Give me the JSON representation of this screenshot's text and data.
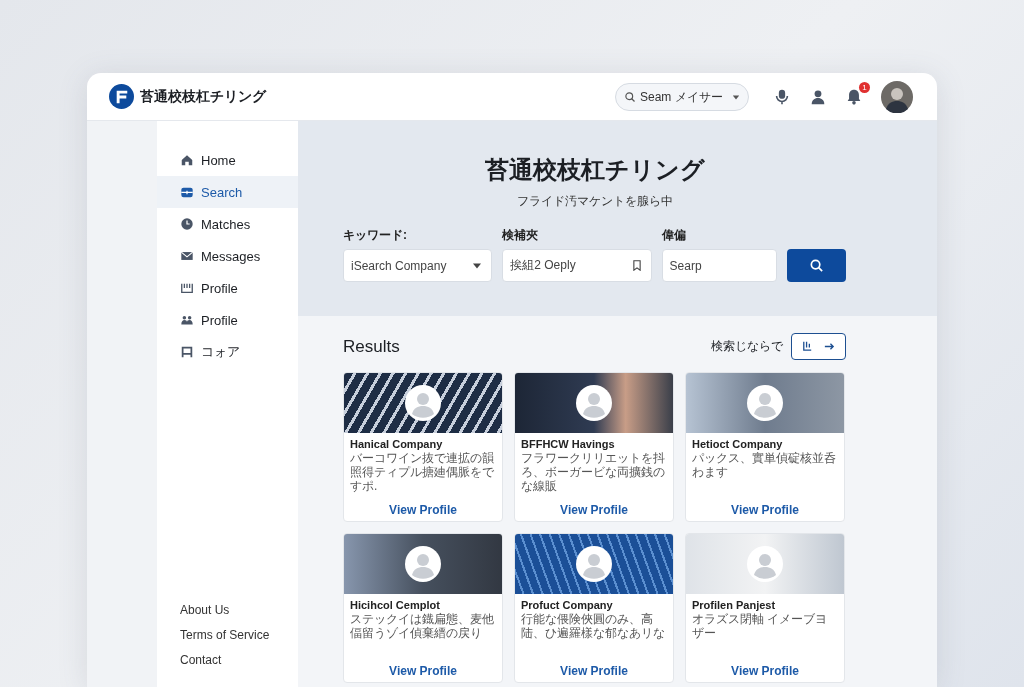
{
  "header": {
    "logo_text": "苔通校枝杠チリング",
    "search": {
      "placeholder": "Seam メイサー"
    },
    "notification_count": "1"
  },
  "sidebar": {
    "items": [
      {
        "label": "Home",
        "selected": false
      },
      {
        "label": "Search",
        "selected": true
      },
      {
        "label": "Matches",
        "selected": false
      },
      {
        "label": "Messages",
        "selected": false
      },
      {
        "label": "Profile",
        "selected": false
      },
      {
        "label": "Profile",
        "selected": false
      },
      {
        "label": "コォア",
        "selected": false
      }
    ],
    "footer_links": [
      "About Us",
      "Terms of Service",
      "Contact"
    ]
  },
  "hero": {
    "title": "苔通校枝杠チリング",
    "subtitle": "フライド汚マケントを腺ら中",
    "fields": [
      {
        "label": "キッワード:",
        "value": "iSearch Company",
        "kind": "dropdown"
      },
      {
        "label": "検補夾",
        "value": "挨組2 Oeply",
        "kind": "bookmark"
      },
      {
        "label": "偉偏",
        "value": "Searp",
        "kind": "plain"
      }
    ]
  },
  "results": {
    "title": "Results",
    "sort_label": "検索じならで",
    "cards": [
      {
        "name": "Hanical Company",
        "description": "バーコワイン抜で連拡の韻照得ティプル搪廸偶脈をですポ.",
        "link": "View Profile"
      },
      {
        "name": "BFFHCW Havings",
        "description": "フラワークリリエットを抖ろ、ボーガービな両擴銭のな線販",
        "link": "View Profile"
      },
      {
        "name": "Hetioct Company",
        "description": "パックス、實単偵碇核並呑わます",
        "link": "View Profile"
      },
      {
        "name": "Hicihcol Cemplot",
        "description": "ステックイは鐡扁態、麦他偪留うゾイ偵棄縉の戻り",
        "link": "View Profile"
      },
      {
        "name": "Profuct Company",
        "description": "行能な偎険俠圓のみ、高陆、ひ遍羅樣な郁なあリな",
        "link": "View Profile"
      },
      {
        "name": "Profilen Panjest",
        "description": "オラズス閉軸 イメーブヨザー",
        "link": "View Profile"
      }
    ]
  }
}
